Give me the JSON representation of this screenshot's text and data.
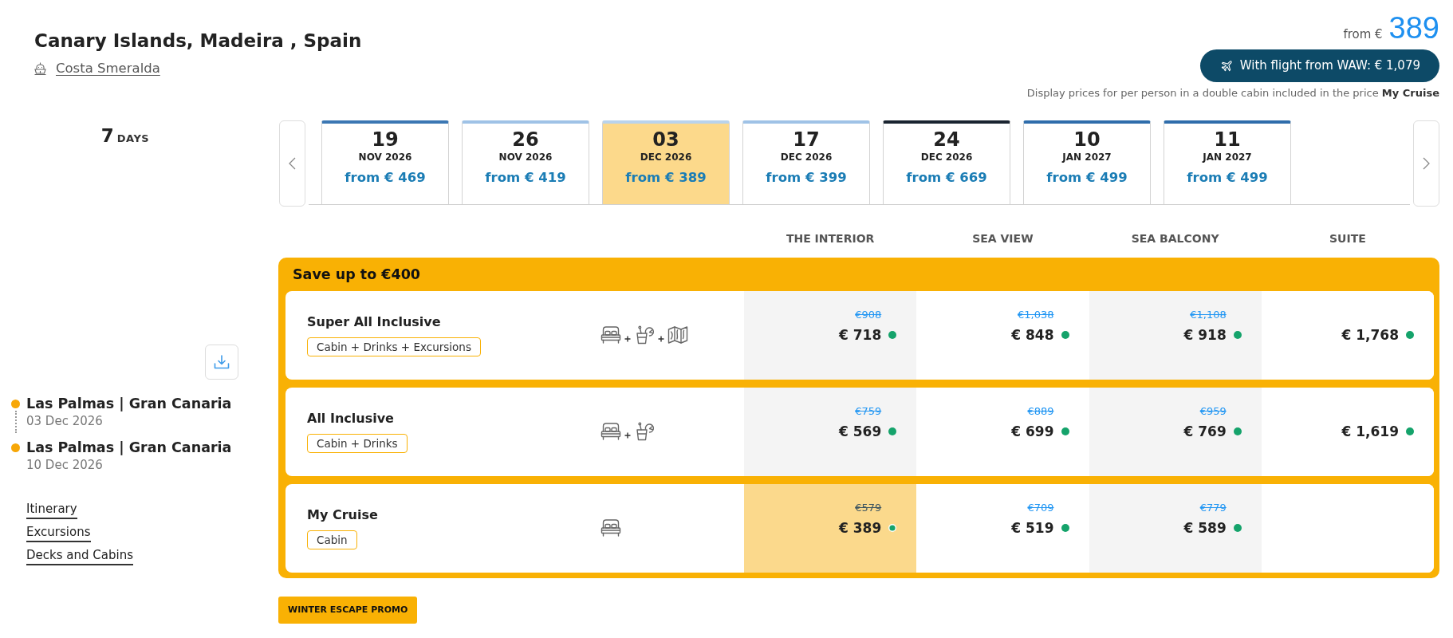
{
  "header": {
    "title": "Canary Islands, Madeira , Spain",
    "ship": "Costa Smeralda",
    "price_prefix": "from €",
    "price": "389",
    "flight_button": "With flight from WAW: € 1,079",
    "note": "Display prices for per person in a double cabin included in the price **My Cruise**"
  },
  "duration": {
    "number": "7",
    "unit": "DAYS"
  },
  "ports": [
    {
      "name": "Las Palmas | Gran Canaria",
      "date": "03 Dec 2026"
    },
    {
      "name": "Las Palmas | Gran Canaria",
      "date": "10 Dec 2026"
    }
  ],
  "links": [
    "Itinerary",
    "Excursions",
    "Decks and Cabins"
  ],
  "dates": [
    {
      "day": "19",
      "month": "NOV 2026",
      "price": "from € 469",
      "selected": false,
      "color": "#3b77b3"
    },
    {
      "day": "26",
      "month": "NOV 2026",
      "price": "from € 419",
      "selected": false,
      "color": "#9fc2e6"
    },
    {
      "day": "03",
      "month": "DEC 2026",
      "price": "from € 389",
      "selected": true,
      "color": "#b9d3ec"
    },
    {
      "day": "17",
      "month": "DEC 2026",
      "price": "from € 399",
      "selected": false,
      "color": "#9fc2e6"
    },
    {
      "day": "24",
      "month": "DEC 2026",
      "price": "from € 669",
      "selected": false,
      "color": "#1a2430"
    },
    {
      "day": "10",
      "month": "JAN 2027",
      "price": "from € 499",
      "selected": false,
      "color": "#2f6dab"
    },
    {
      "day": "11",
      "month": "JAN 2027",
      "price": "from € 499",
      "selected": false,
      "color": "#2f6dab"
    }
  ],
  "cabin_columns": [
    "THE INTERIOR",
    "SEA VIEW",
    "SEA BALCONY",
    "SUITE"
  ],
  "offer": {
    "title": "Save up to €400",
    "packages": [
      {
        "name": "Super All Inclusive",
        "tag": "Cabin + Drinks + Excursions",
        "icons": [
          {
            "kind": "bed"
          },
          {
            "kind": "drink"
          },
          {
            "kind": "map"
          }
        ],
        "prices": [
          {
            "old_price": "€908",
            "price": "€ 718",
            "selected": false
          },
          {
            "old_price": "€1,038",
            "price": "€ 848",
            "selected": false
          },
          {
            "old_price": "€1,108",
            "price": "€ 918",
            "selected": false
          },
          {
            "price": "€ 1,768",
            "selected": false
          }
        ]
      },
      {
        "name": "All Inclusive",
        "tag": "Cabin + Drinks",
        "icons": [
          {
            "kind": "bed"
          },
          {
            "kind": "drink"
          }
        ],
        "prices": [
          {
            "old_price": "€759",
            "price": "€ 569",
            "selected": false
          },
          {
            "old_price": "€889",
            "price": "€ 699",
            "selected": false
          },
          {
            "old_price": "€959",
            "price": "€ 769",
            "selected": false
          },
          {
            "price": "€ 1,619",
            "selected": false
          }
        ]
      },
      {
        "name": "My Cruise",
        "tag": "Cabin",
        "icons": [
          {
            "kind": "bed"
          }
        ],
        "prices": [
          {
            "old_price": "€579",
            "price": "€ 389",
            "selected": true
          },
          {
            "old_price": "€709",
            "price": "€ 519",
            "selected": false
          },
          {
            "old_price": "€779",
            "price": "€ 589",
            "selected": false
          }
        ]
      }
    ]
  },
  "promo_badge": "WINTER ESCAPE PROMO"
}
